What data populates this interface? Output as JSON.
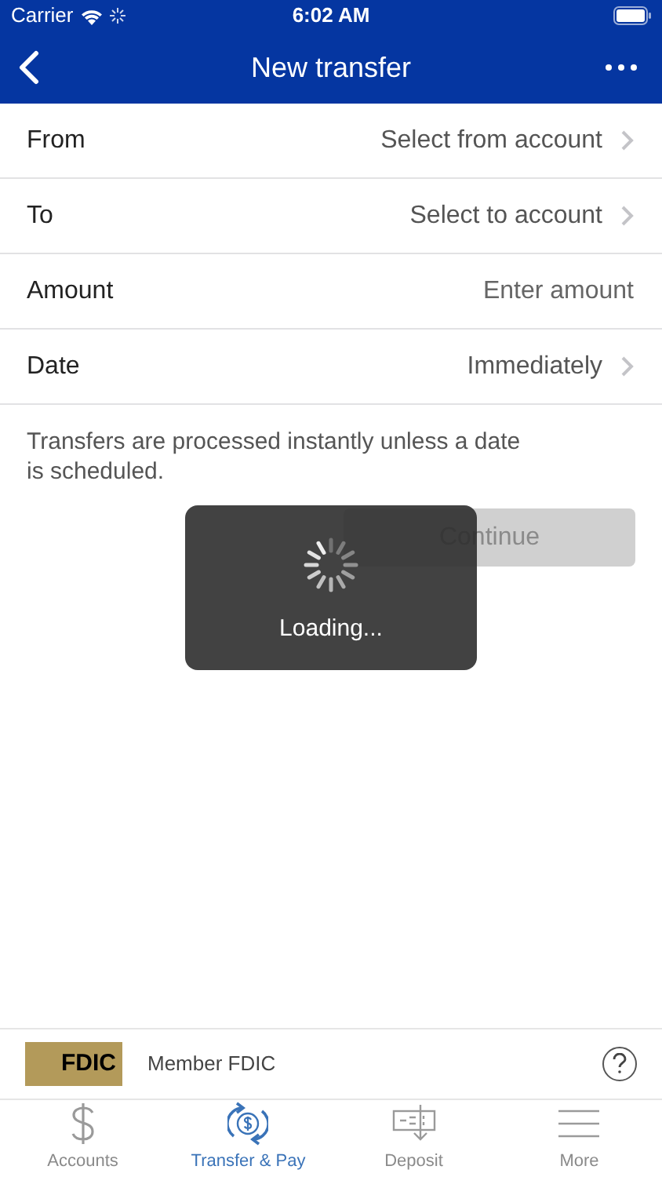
{
  "status_bar": {
    "carrier": "Carrier",
    "time": "6:02 AM"
  },
  "nav": {
    "title": "New transfer"
  },
  "fields": [
    {
      "kind": "select",
      "label": "From",
      "value": "Select from account"
    },
    {
      "kind": "select",
      "label": "To",
      "value": "Select to account"
    },
    {
      "kind": "input",
      "label": "Amount",
      "placeholder": "Enter amount"
    },
    {
      "kind": "select",
      "label": "Date",
      "value": "Immediately"
    }
  ],
  "note": "Transfers are processed instantly unless a date is scheduled.",
  "continue_button": {
    "label": "Continue",
    "disabled": true
  },
  "loading": {
    "label": "Loading..."
  },
  "footer": {
    "logo": "FDIC",
    "text": "Member FDIC"
  },
  "tabs": [
    {
      "label": "Accounts",
      "selected": false
    },
    {
      "label": "Transfer & Pay",
      "selected": true
    },
    {
      "label": "Deposit",
      "selected": false
    },
    {
      "label": "More",
      "selected": false
    }
  ]
}
